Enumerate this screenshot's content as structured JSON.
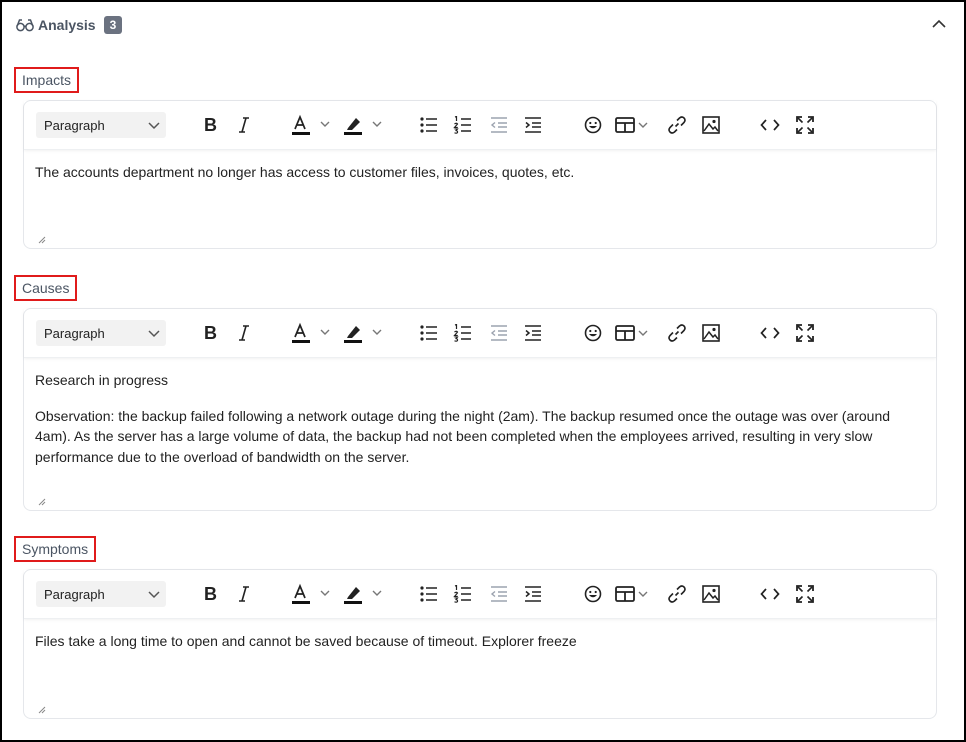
{
  "panel": {
    "title": "Analysis",
    "count": "3"
  },
  "toolbar": {
    "block_format": "Paragraph"
  },
  "sections": [
    {
      "label": "Impacts",
      "paragraphs": [
        "The accounts department no longer has access to customer files, invoices, quotes, etc."
      ]
    },
    {
      "label": "Causes",
      "paragraphs": [
        "Research in progress",
        "Observation: the backup failed following a network outage during the night (2am). The backup resumed once the outage was over (around 4am). As the server has a large volume of data, the backup had not been completed when the employees arrived, resulting in very slow performance due to the overload of bandwidth on the server."
      ]
    },
    {
      "label": "Symptoms",
      "paragraphs": [
        "Files take a long time to open and cannot be saved because of timeout. Explorer freeze"
      ]
    }
  ],
  "colors": {
    "label_border": "#e01b1b",
    "badge_bg": "#6b7280",
    "editor_border": "#e5e7eb"
  },
  "icons": [
    "glasses-icon",
    "chevron-up-icon",
    "bold-icon",
    "italic-icon",
    "text-color-icon",
    "highlight-icon",
    "bullet-list-icon",
    "numbered-list-icon",
    "outdent-icon",
    "indent-icon",
    "emoji-icon",
    "table-icon",
    "link-icon",
    "image-icon",
    "code-icon",
    "fullscreen-icon",
    "resize-handle-icon"
  ]
}
